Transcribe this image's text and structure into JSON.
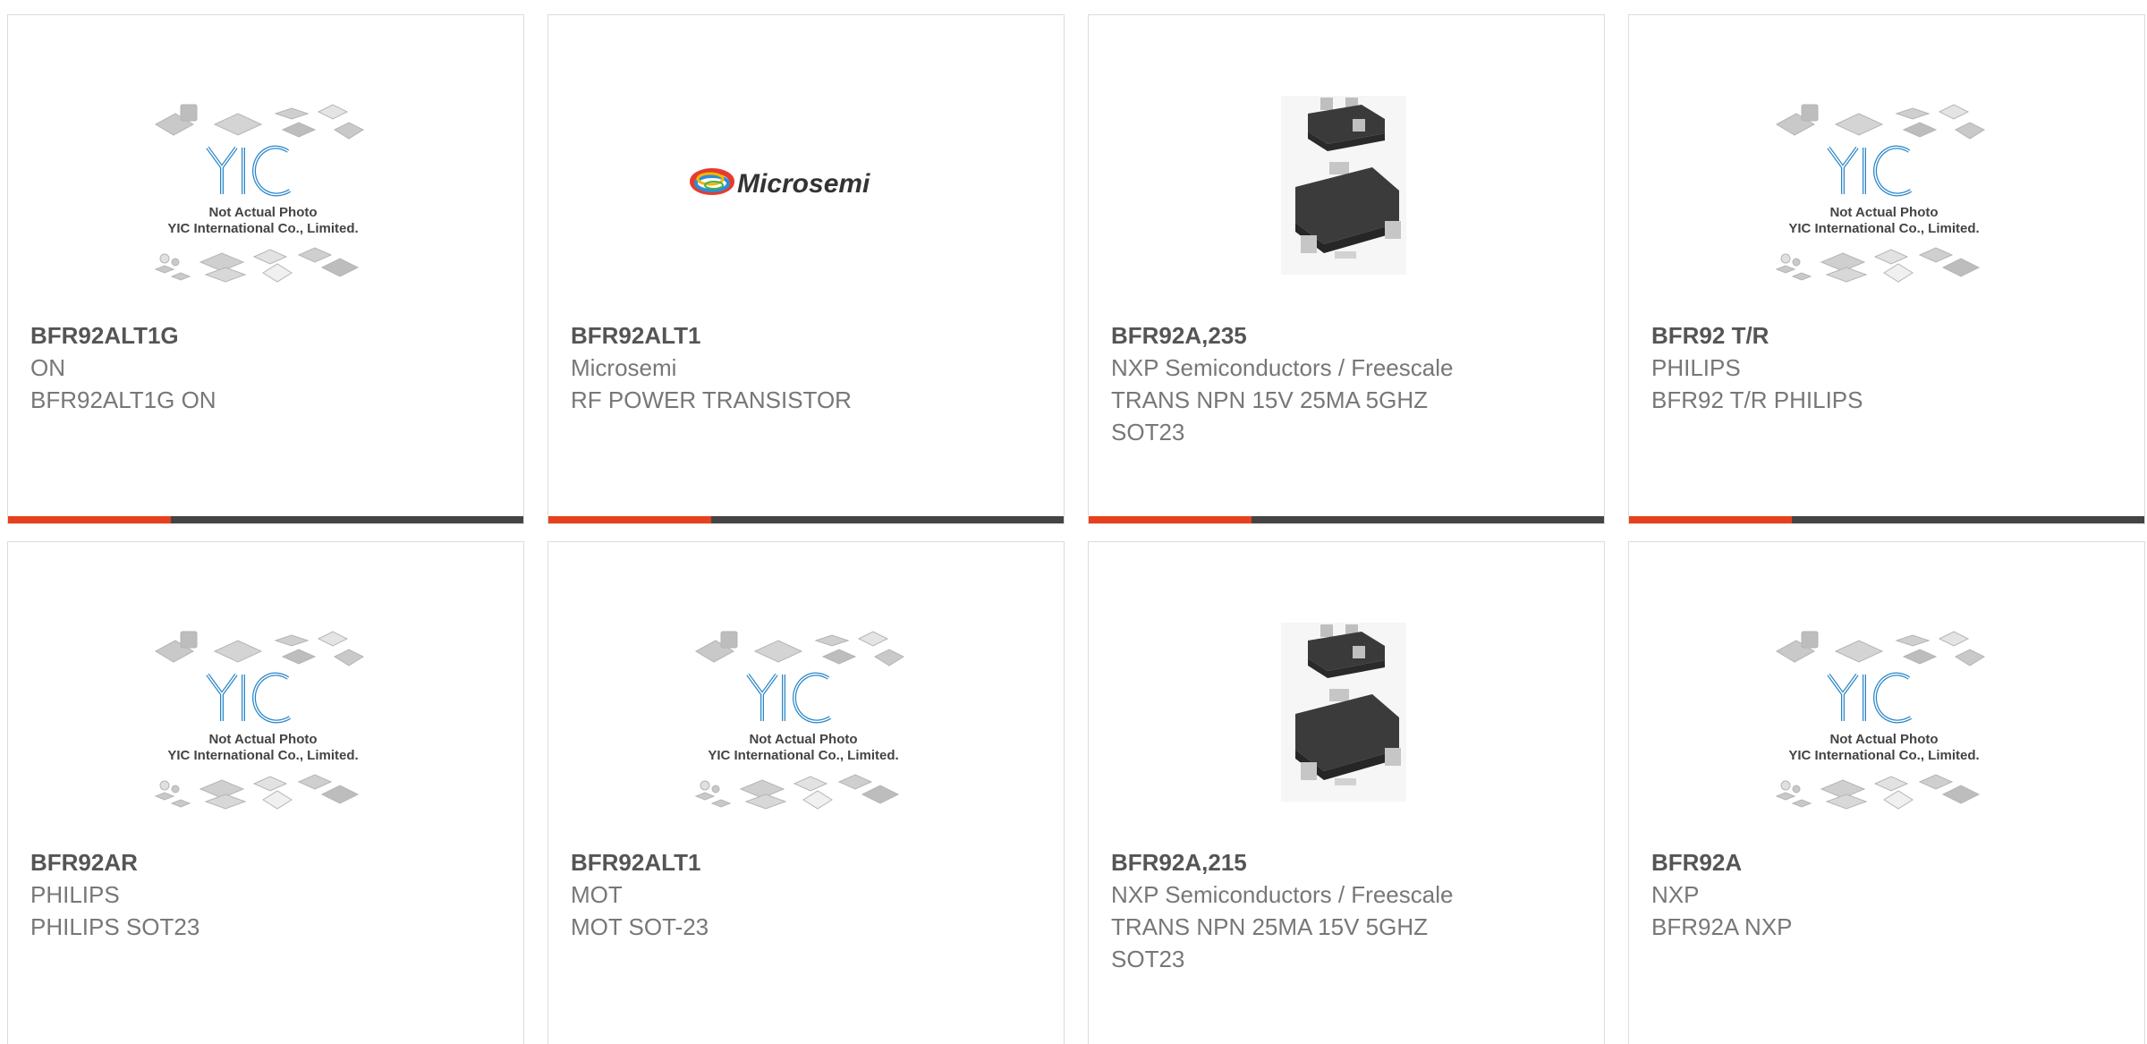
{
  "colors": {
    "accent_orange": "#e8401c",
    "accent_dark": "#444444",
    "yic_blue": "#2a86c8",
    "part_name": "#555555",
    "part_text": "#777777"
  },
  "placeholder": {
    "line1": "Not Actual Photo",
    "line2": "YIC International Co., Limited.",
    "logo": "YIC"
  },
  "brand_logo": {
    "microsemi": "Microsemi"
  },
  "products": [
    {
      "part": "BFR92ALT1G",
      "manufacturer": "ON",
      "description": "BFR92ALT1G ON",
      "image": "yic-placeholder-icon"
    },
    {
      "part": "BFR92ALT1",
      "manufacturer": "Microsemi",
      "description": "RF POWER TRANSISTOR",
      "image": "microsemi-logo"
    },
    {
      "part": "BFR92A,235",
      "manufacturer": "NXP Semiconductors / Freescale",
      "description": "TRANS NPN 15V 25MA 5GHZ SOT23",
      "image": "sot23-package-icon"
    },
    {
      "part": "BFR92 T/R",
      "manufacturer": "PHILIPS",
      "description": "BFR92 T/R PHILIPS",
      "image": "yic-placeholder-icon"
    },
    {
      "part": "BFR92AR",
      "manufacturer": "PHILIPS",
      "description": "PHILIPS SOT23",
      "image": "yic-placeholder-icon"
    },
    {
      "part": "BFR92ALT1",
      "manufacturer": "MOT",
      "description": "MOT SOT-23",
      "image": "yic-placeholder-icon"
    },
    {
      "part": "BFR92A,215",
      "manufacturer": "NXP Semiconductors / Freescale",
      "description": "TRANS NPN 25MA 15V 5GHZ SOT23",
      "image": "sot23-package-icon"
    },
    {
      "part": "BFR92A",
      "manufacturer": "NXP",
      "description": "BFR92A NXP",
      "image": "yic-placeholder-icon"
    }
  ]
}
